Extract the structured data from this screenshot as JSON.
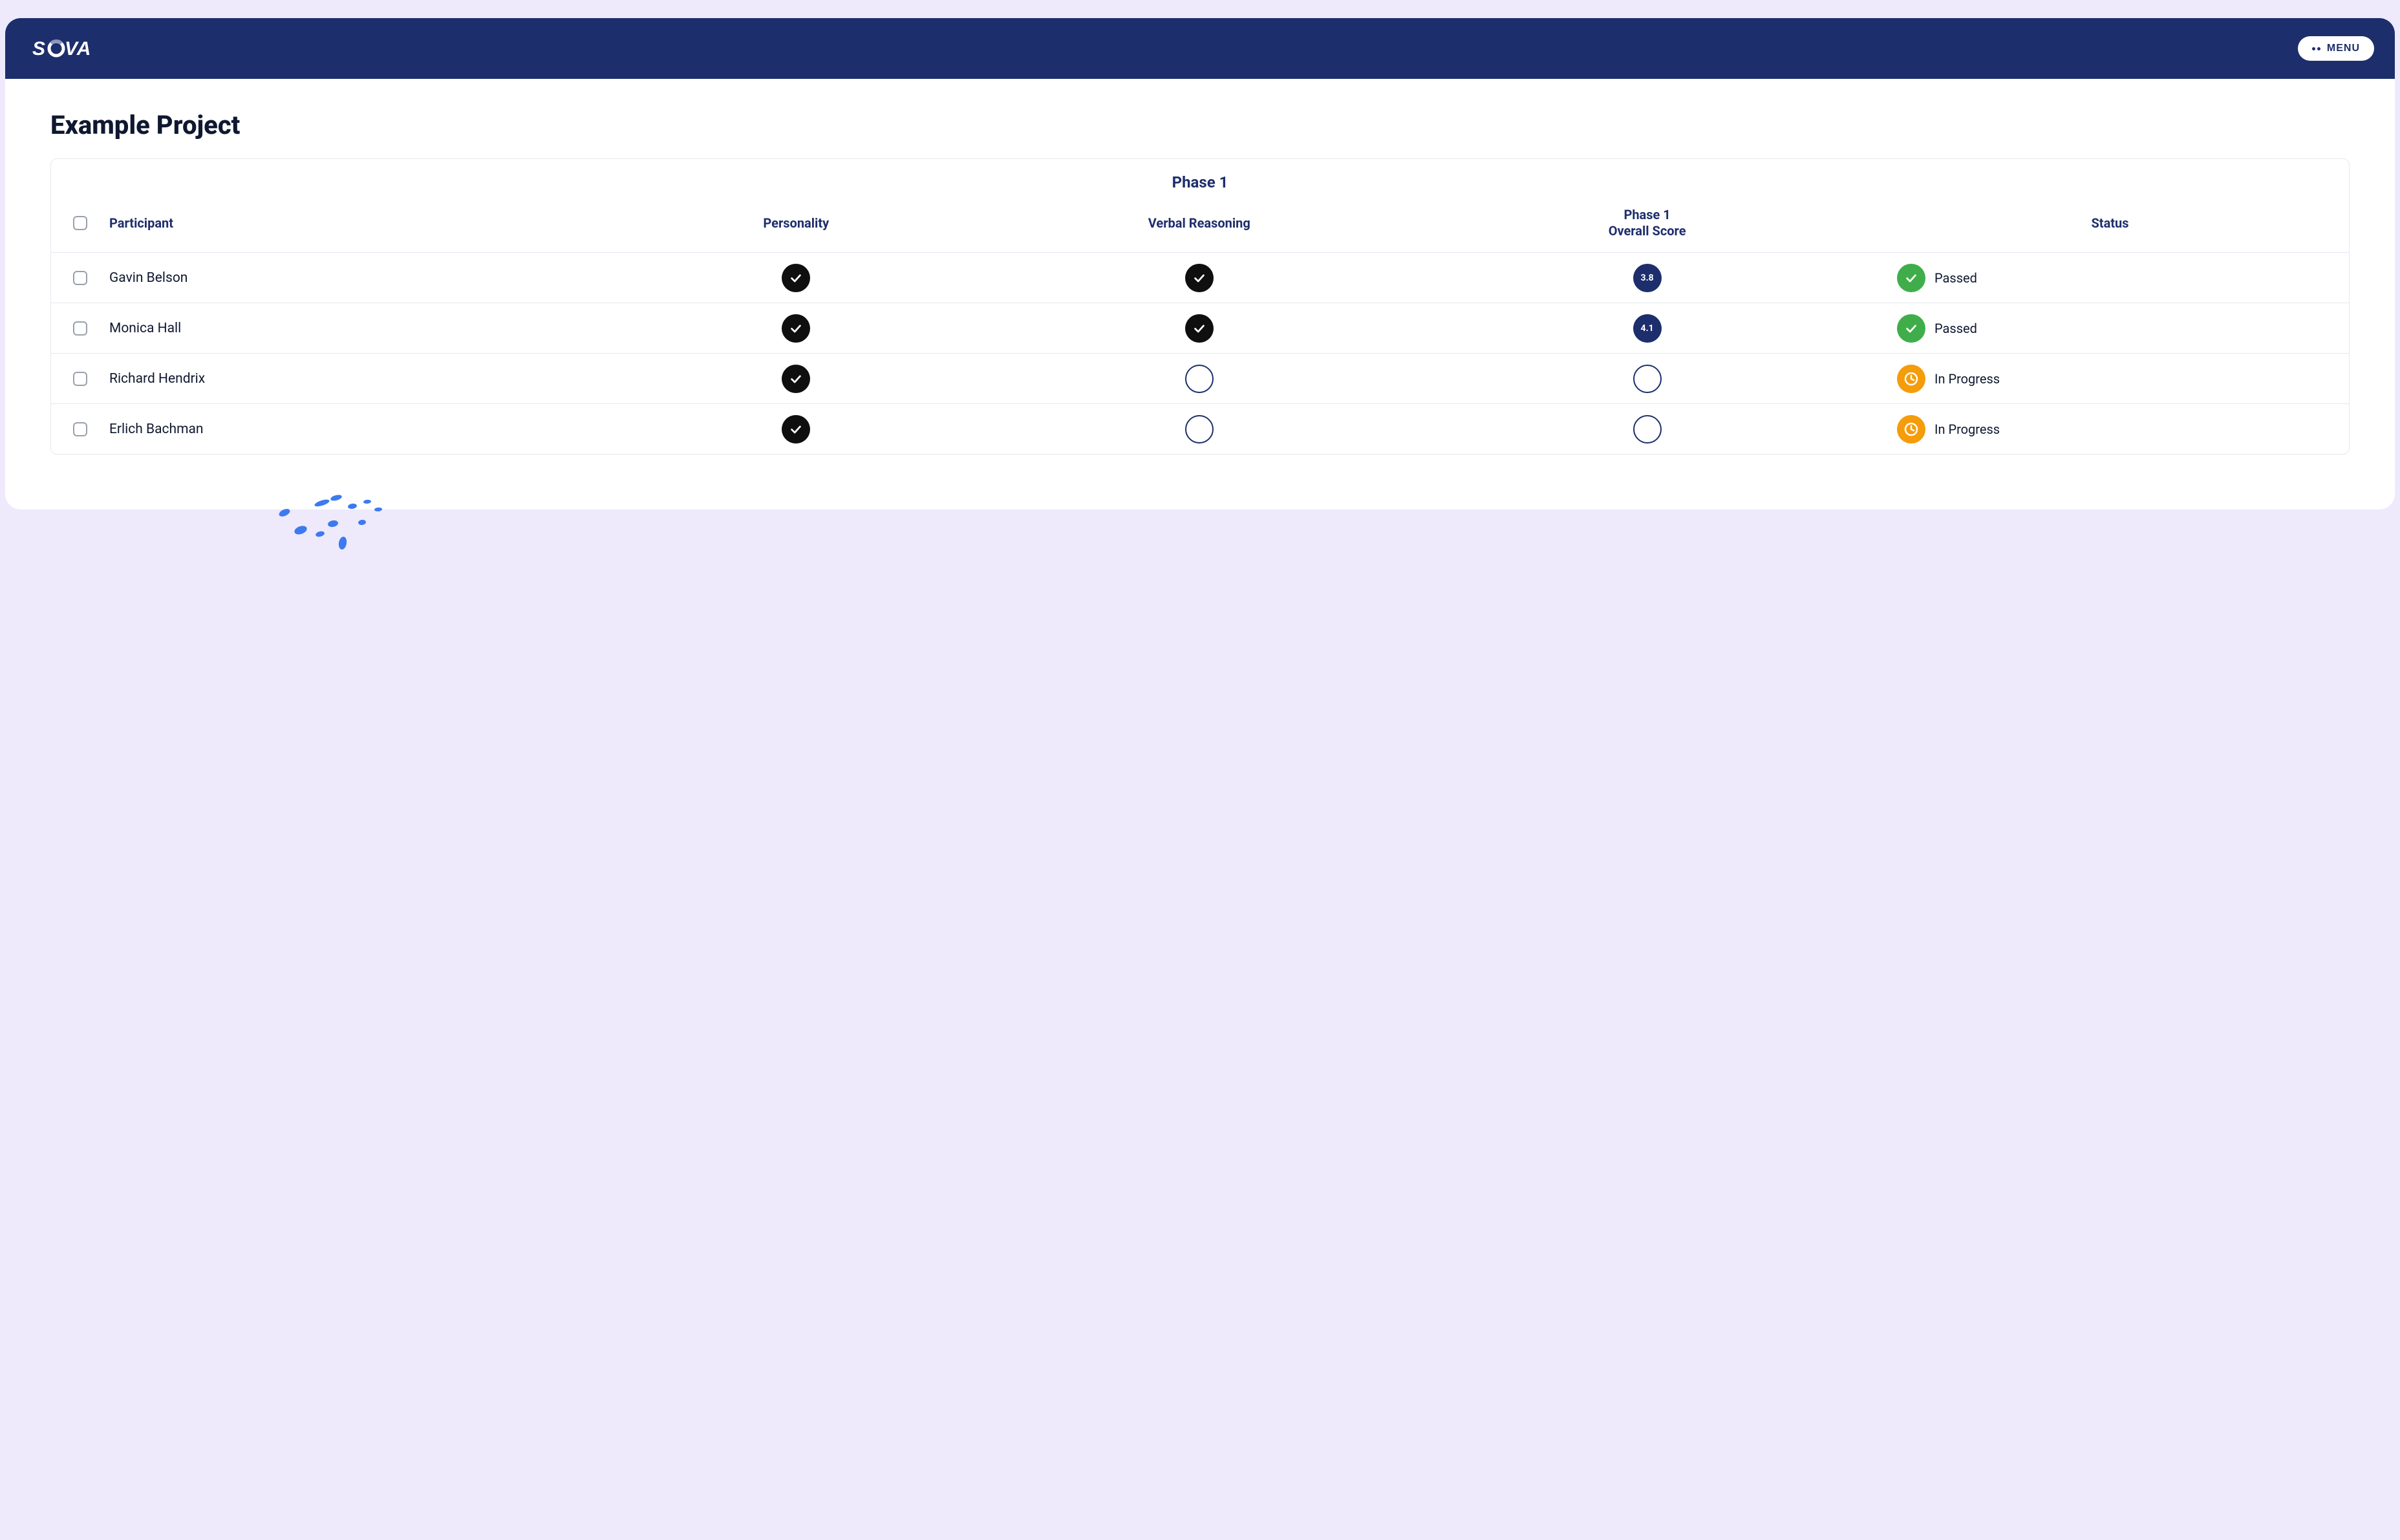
{
  "header": {
    "brand": "SOVA",
    "menu_label": "MENU"
  },
  "page": {
    "title": "Example Project"
  },
  "table": {
    "phase_label": "Phase 1",
    "columns": {
      "participant": "Participant",
      "personality": "Personality",
      "verbal": "Verbal Reasoning",
      "overall": "Phase 1\nOverall Score",
      "status": "Status"
    },
    "rows": [
      {
        "name": "Gavin Belson",
        "personality": "done",
        "verbal": "done",
        "score": "3.8",
        "status": {
          "kind": "passed",
          "label": "Passed"
        }
      },
      {
        "name": "Monica Hall",
        "personality": "done",
        "verbal": "done",
        "score": "4.1",
        "status": {
          "kind": "passed",
          "label": "Passed"
        }
      },
      {
        "name": "Richard Hendrix",
        "personality": "done",
        "verbal": "empty",
        "score": "",
        "status": {
          "kind": "inprogress",
          "label": "In Progress"
        }
      },
      {
        "name": "Erlich Bachman",
        "personality": "done",
        "verbal": "empty",
        "score": "",
        "status": {
          "kind": "inprogress",
          "label": "In Progress"
        }
      }
    ]
  },
  "colors": {
    "brand_navy": "#1d2e6c",
    "status_green": "#3fae4a",
    "status_orange": "#f59c0b",
    "page_bg": "#eeeafc"
  }
}
